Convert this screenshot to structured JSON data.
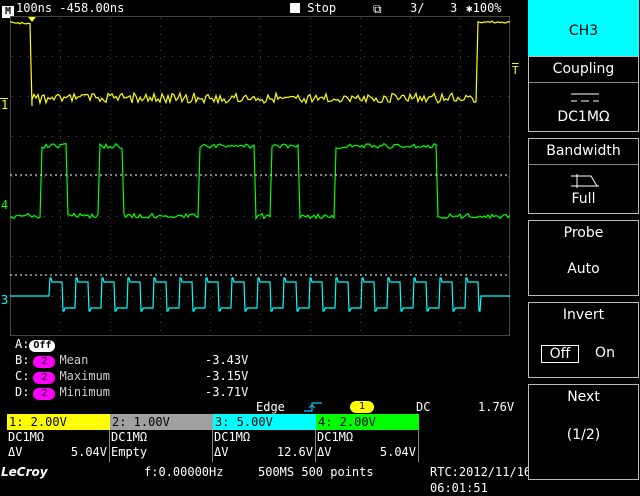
{
  "status": {
    "mode_icon": "M",
    "timebase": "100ns -458.00ns",
    "run_state": "Stop",
    "acq_count": "3/",
    "acq_total": "3",
    "zoom": "100%"
  },
  "markers": {
    "ch1": "1",
    "ch4": "4",
    "ch3": "3",
    "trigger_level": "T"
  },
  "measurements": [
    {
      "slot": "A:",
      "state": "Off",
      "channel": "",
      "name": "",
      "value": ""
    },
    {
      "slot": "B:",
      "state": "",
      "channel": "2",
      "name": "Mean",
      "value": "-3.43V"
    },
    {
      "slot": "C:",
      "state": "",
      "channel": "2",
      "name": "Maximum",
      "value": "-3.15V"
    },
    {
      "slot": "D:",
      "state": "",
      "channel": "2",
      "name": "Minimum",
      "value": "-3.71V"
    }
  ],
  "trigger": {
    "type": "Edge",
    "source": "1",
    "coupling": "DC",
    "level": "1.76V"
  },
  "channels": [
    {
      "label": "1: 2.00V",
      "coupling": "DC1MΩ",
      "dv_label": "ΔV",
      "dv": "5.04V",
      "color": "#ffff00"
    },
    {
      "label": "2: 1.00V",
      "coupling": "DC1MΩ",
      "dv_label": "Empty",
      "dv": "",
      "color": "#a0a0a0"
    },
    {
      "label": "3: 5.00V",
      "coupling": "DC1MΩ",
      "dv_label": "ΔV",
      "dv": "12.6V",
      "color": "#00ffff"
    },
    {
      "label": "4: 2.00V",
      "coupling": "DC1MΩ",
      "dv_label": "ΔV",
      "dv": "5.04V",
      "color": "#00ff00"
    }
  ],
  "footer": {
    "brand": "LeCroy",
    "frequency": "f:0.00000Hz",
    "sample": "500MS 500 points",
    "rtc": "RTC:2012/11/16 06:01:51"
  },
  "panel": {
    "title": "CH3",
    "buttons": [
      {
        "header": "Coupling",
        "value": "DC1MΩ"
      },
      {
        "header": "Bandwidth",
        "value": "Full"
      },
      {
        "header": "Probe",
        "value": "Auto"
      },
      {
        "header": "Invert",
        "off": "Off",
        "on": "On"
      },
      {
        "header": "Next",
        "value": "(1/2)"
      }
    ]
  },
  "colors": {
    "ch1": "#ffff00",
    "ch3": "#00ffff",
    "ch4": "#00ff00",
    "math": "#ff00ff",
    "panel_active": "#00ffff"
  }
}
